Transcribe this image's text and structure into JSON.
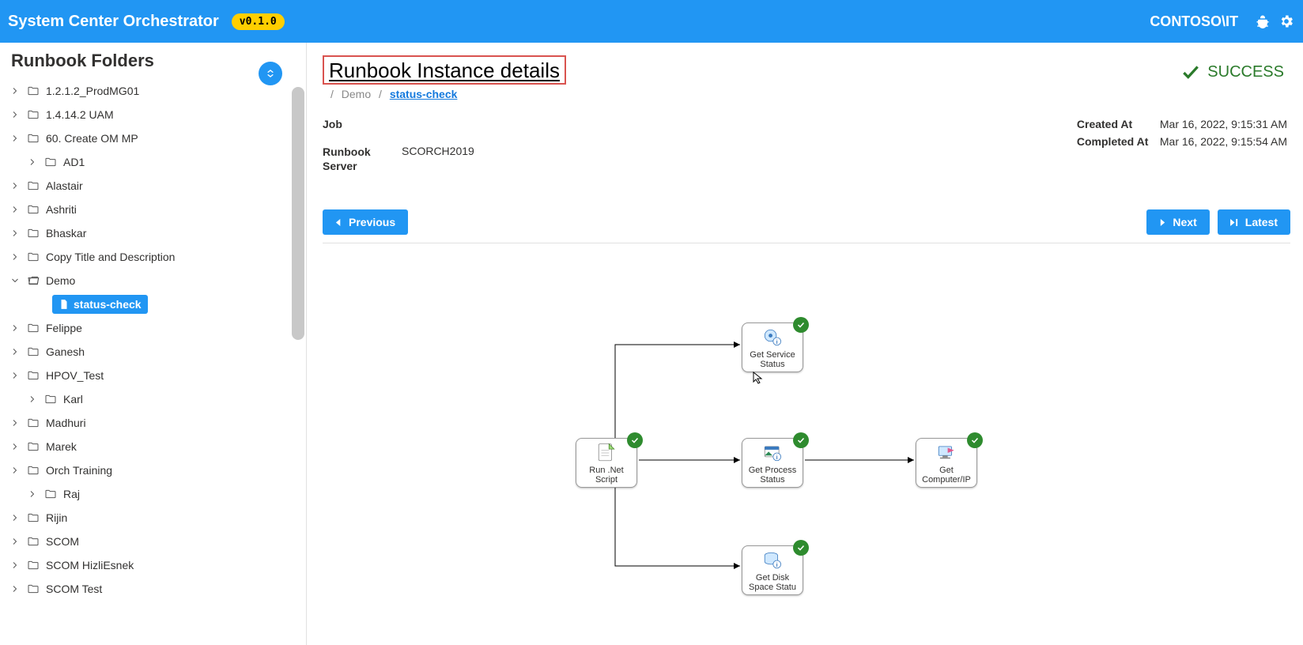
{
  "header": {
    "app_title": "System Center Orchestrator",
    "version": "v0.1.0",
    "user": "CONTOSO\\IT"
  },
  "sidebar": {
    "title": "Runbook Folders",
    "items": [
      {
        "label": "1.2.1.2_ProdMG01",
        "expanded": false,
        "indent": 0
      },
      {
        "label": "1.4.14.2 UAM",
        "expanded": false,
        "indent": 0
      },
      {
        "label": "60. Create OM MP",
        "expanded": false,
        "indent": 0
      },
      {
        "label": "AD1",
        "expanded": false,
        "indent": 1
      },
      {
        "label": "Alastair",
        "expanded": false,
        "indent": 0
      },
      {
        "label": "Ashriti",
        "expanded": false,
        "indent": 0
      },
      {
        "label": "Bhaskar",
        "expanded": false,
        "indent": 0
      },
      {
        "label": "Copy Title and Description",
        "expanded": false,
        "indent": 0
      },
      {
        "label": "Demo",
        "expanded": true,
        "indent": 0,
        "open": true
      },
      {
        "label": "status-check",
        "file": true,
        "selected": true,
        "indent": 2
      },
      {
        "label": "Felippe",
        "expanded": false,
        "indent": 0
      },
      {
        "label": "Ganesh",
        "expanded": false,
        "indent": 0
      },
      {
        "label": "HPOV_Test",
        "expanded": false,
        "indent": 0
      },
      {
        "label": "Karl",
        "expanded": false,
        "indent": 1
      },
      {
        "label": "Madhuri",
        "expanded": false,
        "indent": 0
      },
      {
        "label": "Marek",
        "expanded": false,
        "indent": 0
      },
      {
        "label": "Orch Training",
        "expanded": false,
        "indent": 0
      },
      {
        "label": "Raj",
        "expanded": false,
        "indent": 1
      },
      {
        "label": "Rijin",
        "expanded": false,
        "indent": 0
      },
      {
        "label": "SCOM",
        "expanded": false,
        "indent": 0
      },
      {
        "label": "SCOM HizliEsnek",
        "expanded": false,
        "indent": 0
      },
      {
        "label": "SCOM Test",
        "expanded": false,
        "indent": 0
      }
    ]
  },
  "main": {
    "page_title": "Runbook Instance details",
    "breadcrumb": {
      "parent": "Demo",
      "current": "status-check"
    },
    "status": "SUCCESS",
    "job_label": "Job",
    "runbook_server_label": "Runbook Server",
    "runbook_server_value": "SCORCH2019",
    "created_label": "Created At",
    "created_value": "Mar 16, 2022, 9:15:31 AM",
    "completed_label": "Completed At",
    "completed_value": "Mar 16, 2022, 9:15:54 AM",
    "buttons": {
      "previous": "Previous",
      "next": "Next",
      "latest": "Latest"
    },
    "nodes": {
      "run_net": "Run .Net Script",
      "get_service": "Get Service Status",
      "get_process": "Get Process Status",
      "get_disk": "Get Disk Space Statu",
      "get_comp": "Get Computer/IP"
    }
  }
}
